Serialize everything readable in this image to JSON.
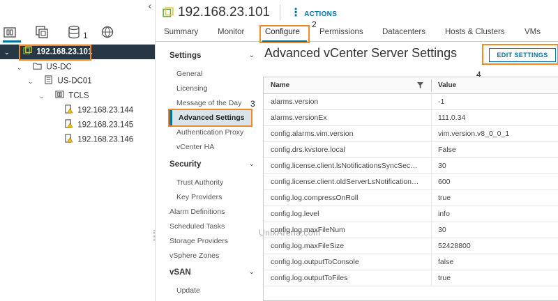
{
  "inventory": {
    "collapse_glyph": "‹",
    "tabs": [
      {
        "name": "hosts-clusters",
        "icon": "hosts-clusters-icon"
      },
      {
        "name": "vms-templates",
        "icon": "vms-templates-icon"
      },
      {
        "name": "storage",
        "icon": "storage-icon"
      },
      {
        "name": "networking",
        "icon": "network-icon"
      }
    ],
    "callout_1": "1",
    "tree": [
      {
        "label": "192.168.23.101",
        "icon": "vcenter-icon",
        "selected": true
      },
      {
        "label": "US-DC",
        "icon": "folder-icon"
      },
      {
        "label": "US-DC01",
        "icon": "datacenter-icon"
      },
      {
        "label": "TCLS",
        "icon": "cluster-icon"
      },
      {
        "label": "192.168.23.144",
        "icon": "host-warning-icon"
      },
      {
        "label": "192.168.23.145",
        "icon": "host-warning-icon"
      },
      {
        "label": "192.168.23.146",
        "icon": "host-warning-icon"
      }
    ]
  },
  "header": {
    "title": "192.168.23.101",
    "actions_label": "ACTIONS"
  },
  "main_tabs": [
    "Summary",
    "Monitor",
    "Configure",
    "Permissions",
    "Datacenters",
    "Hosts & Clusters",
    "VMs"
  ],
  "callout_2": "2",
  "settings_nav": {
    "groups": {
      "settings": "Settings",
      "security": "Security",
      "vsan": "vSAN"
    },
    "settings_items": [
      "General",
      "Licensing",
      "Message of the Day",
      "Advanced Settings",
      "Authentication Proxy",
      "vCenter HA"
    ],
    "security_items": [
      "Trust Authority",
      "Key Providers"
    ],
    "top_items": [
      "Alarm Definitions",
      "Scheduled Tasks",
      "Storage Providers",
      "vSphere Zones"
    ],
    "vsan_items": [
      "Update"
    ],
    "callout_3": "3"
  },
  "panel": {
    "title": "Advanced vCenter Server Settings",
    "edit_button": "EDIT SETTINGS",
    "callout_4": "4",
    "columns": {
      "name": "Name",
      "value": "Value"
    },
    "rows": [
      {
        "name": "alarms.version",
        "value": "-1"
      },
      {
        "name": "alarms.versionEx",
        "value": "111.0.34"
      },
      {
        "name": "config.alarms.vim.version",
        "value": "vim.version.v8_0_0_1"
      },
      {
        "name": "config.drs.kvstore.local",
        "value": "False"
      },
      {
        "name": "config.license.client.lsNotificationsSyncSec…",
        "value": "30"
      },
      {
        "name": "config.license.client.oldServerLsNotification…",
        "value": "600"
      },
      {
        "name": "config.log.compressOnRoll",
        "value": "true"
      },
      {
        "name": "config.log.level",
        "value": "info"
      },
      {
        "name": "config.log.maxFileNum",
        "value": "30"
      },
      {
        "name": "config.log.maxFileSize",
        "value": "52428800"
      },
      {
        "name": "config.log.outputToConsole",
        "value": "false"
      },
      {
        "name": "config.log.outputToFiles",
        "value": "true"
      }
    ]
  },
  "watermark": "UnixArena.com",
  "colors": {
    "accent": "#0072a3",
    "highlight_box": "#f08a24",
    "selected_row_bg": "#273746",
    "warning": "#f0c000",
    "vcenter_green": "#6db33f"
  }
}
